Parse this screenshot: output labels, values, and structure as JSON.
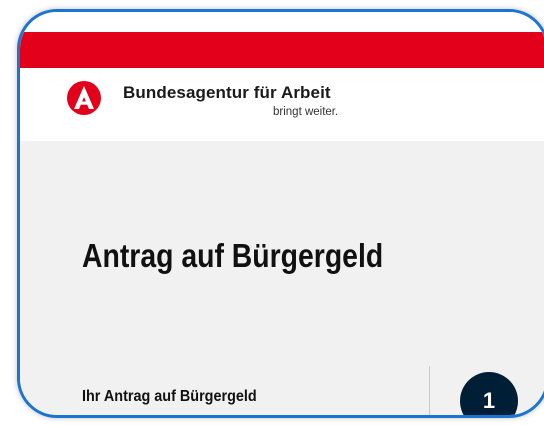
{
  "header": {
    "brand_name": "Bundesagentur für Arbeit",
    "tagline": "bringt weiter.",
    "logo_icon": "ba-logo-icon"
  },
  "main": {
    "page_title": "Antrag auf Bürgergeld",
    "step": {
      "label": "Ihr Antrag auf Bürgergeld",
      "number": "1"
    }
  },
  "colors": {
    "brand_red": "#e2001a",
    "frame_blue": "#1b74d0",
    "step_badge": "#001e36",
    "page_background": "#f1f1f1"
  }
}
